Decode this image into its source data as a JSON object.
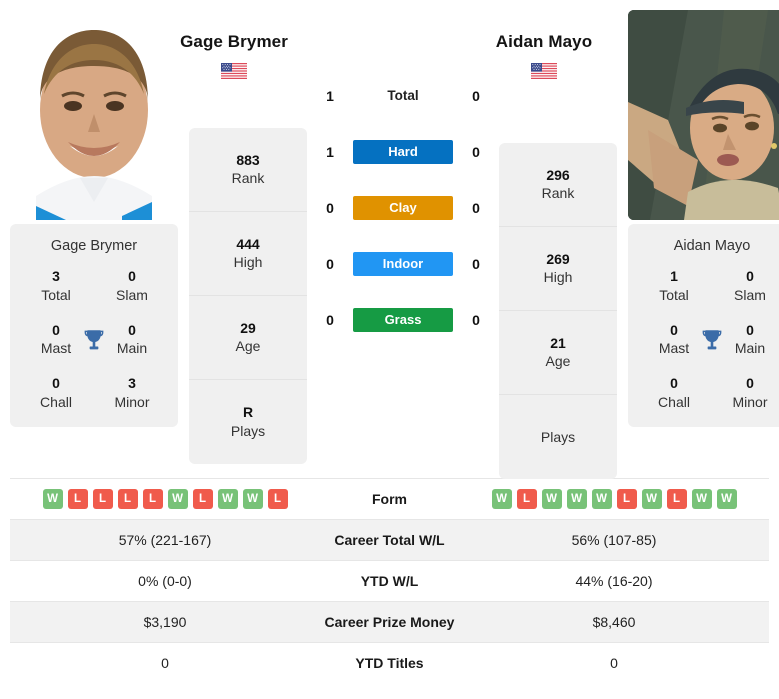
{
  "players": {
    "left": {
      "name": "Gage Brymer",
      "flag_alt": "United States flag",
      "summary_name": "Gage Brymer",
      "titles": {
        "total_val": "3",
        "total_lbl": "Total",
        "slam_val": "0",
        "slam_lbl": "Slam",
        "mast_val": "0",
        "mast_lbl": "Mast",
        "main_val": "0",
        "main_lbl": "Main",
        "chall_val": "0",
        "chall_lbl": "Chall",
        "minor_val": "3",
        "minor_lbl": "Minor"
      },
      "ranks": [
        {
          "value": "883",
          "label": "Rank"
        },
        {
          "value": "444",
          "label": "High"
        },
        {
          "value": "29",
          "label": "Age"
        },
        {
          "value": "R",
          "label": "Plays"
        }
      ],
      "form": [
        "W",
        "L",
        "L",
        "L",
        "L",
        "W",
        "L",
        "W",
        "W",
        "L"
      ],
      "career_wl": "57% (221-167)",
      "ytd_wl": "0% (0-0)",
      "prize": "$3,190",
      "ytd_titles": "0"
    },
    "right": {
      "name": "Aidan Mayo",
      "flag_alt": "United States flag",
      "summary_name": "Aidan Mayo",
      "titles": {
        "total_val": "1",
        "total_lbl": "Total",
        "slam_val": "0",
        "slam_lbl": "Slam",
        "mast_val": "0",
        "mast_lbl": "Mast",
        "main_val": "0",
        "main_lbl": "Main",
        "chall_val": "0",
        "chall_lbl": "Chall",
        "minor_val": "0",
        "minor_lbl": "Minor"
      },
      "ranks": [
        {
          "value": "296",
          "label": "Rank"
        },
        {
          "value": "269",
          "label": "High"
        },
        {
          "value": "21",
          "label": "Age"
        },
        {
          "value": "",
          "label": "Plays"
        }
      ],
      "form": [
        "W",
        "L",
        "W",
        "W",
        "W",
        "L",
        "W",
        "L",
        "W",
        "W"
      ],
      "career_wl": "56% (107-85)",
      "ytd_wl": "44% (16-20)",
      "prize": "$8,460",
      "ytd_titles": "0"
    }
  },
  "surfaces": [
    {
      "label": "Total",
      "left": "1",
      "right": "0",
      "color": "transparent",
      "plain": true
    },
    {
      "label": "Hard",
      "left": "1",
      "right": "0",
      "color": "#0571c1",
      "plain": false
    },
    {
      "label": "Clay",
      "left": "0",
      "right": "0",
      "color": "#e09200",
      "plain": false
    },
    {
      "label": "Indoor",
      "left": "0",
      "right": "0",
      "color": "#2196f3",
      "plain": false
    },
    {
      "label": "Grass",
      "left": "0",
      "right": "0",
      "color": "#169b44",
      "plain": false
    }
  ],
  "table_rows": [
    {
      "label": "Form",
      "left": "",
      "right": "",
      "type": "form",
      "shaded": false
    },
    {
      "label": "Career Total W/L",
      "left": "57% (221-167)",
      "right": "56% (107-85)",
      "type": "text",
      "shaded": true
    },
    {
      "label": "YTD W/L",
      "left": "0% (0-0)",
      "right": "44% (16-20)",
      "type": "text",
      "shaded": false
    },
    {
      "label": "Career Prize Money",
      "left": "$3,190",
      "right": "$8,460",
      "type": "text",
      "shaded": true
    },
    {
      "label": "YTD Titles",
      "left": "0",
      "right": "0",
      "type": "text",
      "shaded": false
    }
  ],
  "colors": {
    "hard": "#0571c1",
    "clay": "#e09200",
    "indoor": "#2196f3",
    "grass": "#169b44",
    "win": "#78c278",
    "loss": "#f05b4c",
    "card_bg": "#f0f0f0",
    "row_shade": "#f2f2f2",
    "trophy": "#3b6ca8"
  }
}
